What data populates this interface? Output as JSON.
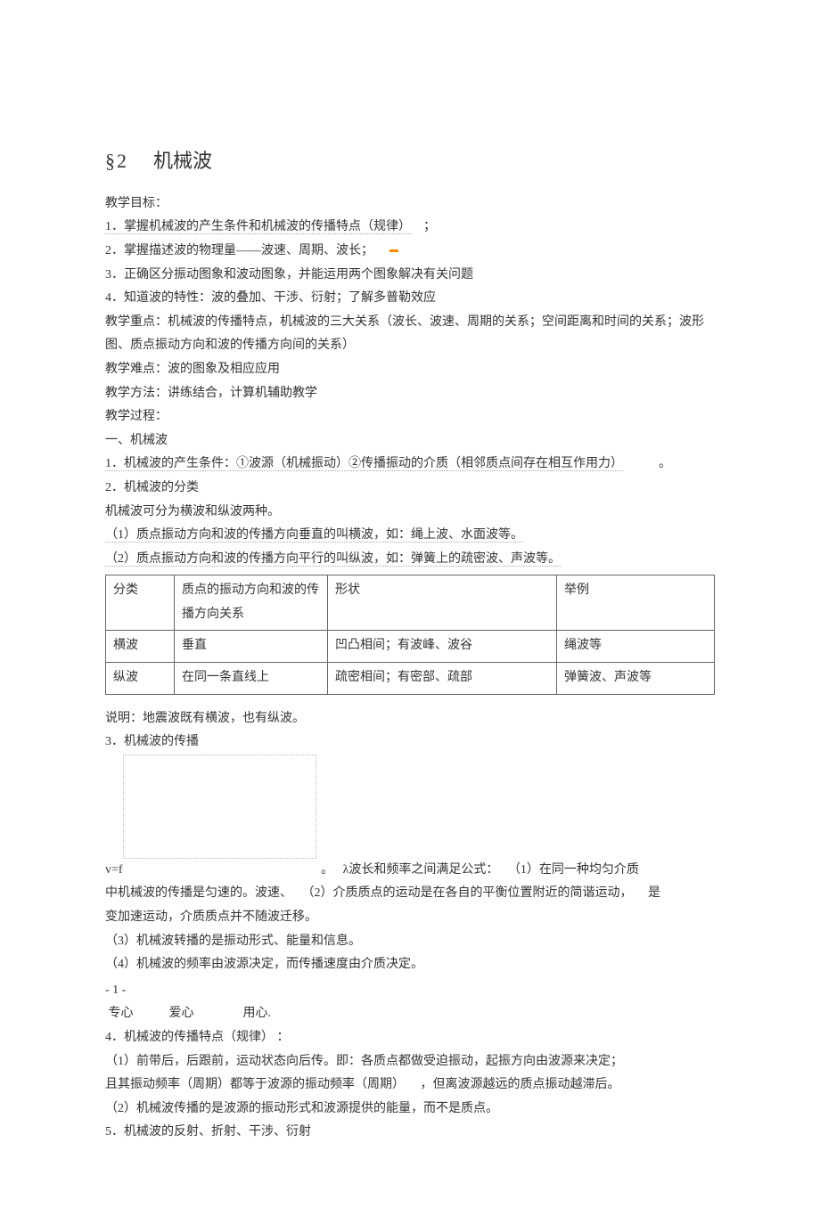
{
  "title": {
    "num": "§2",
    "text": "机械波"
  },
  "goals_heading": "教学目标：",
  "goals": {
    "g1a": "1．掌握机械波的产生条件和机械波的传播特点（规律）",
    "g1b": "；",
    "g2": "2．掌握描述波的物理量——波速、周期、波长；",
    "g3": "3．正确区分振动图象和波动图象，并能运用两个图象解决有关问题",
    "g4": "4．知道波的特性：波的叠加、干涉、衍射；了解多普勒效应"
  },
  "keypoint": "教学重点：机械波的传播特点，机械波的三大关系（波长、波速、周期的关系；空间距离和时间的关系；波形图、质点振动方向和波的传播方向间的关系）",
  "difficulty": "教学难点：波的图象及相应应用",
  "method": "教学方法：讲练结合，计算机辅助教学",
  "process": "教学过程：",
  "sec1": "一、机械波",
  "p1": "1．机械波的产生条件：①波源（机械振动）②传播振动的介质（相邻质点间存在相互作用力）",
  "p1_end": "。",
  "p2": "2．机械波的分类",
  "p2a": "机械波可分为横波和纵波两种。",
  "p2b": "（1）质点振动方向和波的传播方向垂直的叫横波，如：绳上波、水面波等。",
  "p2c": "（2）质点振动方向和波的传播方向平行的叫纵波，如：弹簧上的疏密波、声波等。",
  "table": {
    "h1": "分类",
    "h2": "质点的振动方向和波的传播方向关系",
    "h3": "形状",
    "h4": "举例",
    "r1c1": "横波",
    "r1c2": "垂直",
    "r1c3": "凹凸相间；有波峰、波谷",
    "r1c4": "绳波等",
    "r2c1": "纵波",
    "r2c2": "在同一条直线上",
    "r2c3": "疏密相间；有密部、疏部",
    "r2c4": "弹簧波、声波等"
  },
  "note": "说明：地震波既有横波，也有纵波。",
  "p3": "3．机械波的传播",
  "p3a_pre": "v=f",
  "p3a_dot": "。",
  "p3a_mid": "λ波长和频率之间满足公式：",
  "p3a_end": "（1）在同一种均匀介质",
  "p3b_a": "中机械波的传播是匀速的。波速、",
  "p3b_b": "（2）介质质点的运动是在各自的平衡位置附近的简谐运动，",
  "p3b_c": "是",
  "p3c": "变加速运动，介质质点并不随波迁移。",
  "p3d": "（3）机械波转播的是振动形式、能量和信息。",
  "p3e": "（4）机械波的频率由波源决定，而传播速度由介质决定。",
  "pagenum": "- 1 -",
  "footer": {
    "a": "专心",
    "b": "爱心",
    "c": "用心."
  },
  "p4": "4．机械波的传播特点（规律）  ：",
  "p4a": "（1）前带后，后跟前，运动状态向后传。即：各质点都做受迫振动，起振方向由波源来决定；",
  "p4b_a": "且其振动频率（周期）都等于波源的振动频率（周期）",
  "p4b_b": "，但离波源越远的质点振动越滞后。",
  "p4c": "（2）机械波传播的是波源的振动形式和波源提供的能量，而不是质点。",
  "p5": "5．机械波的反射、折射、干涉、衍射"
}
